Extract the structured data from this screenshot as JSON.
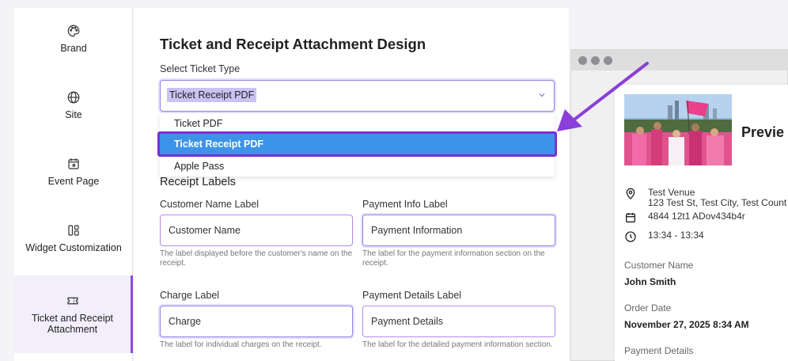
{
  "sidebar": {
    "items": [
      {
        "label": "Brand",
        "icon": "palette-icon"
      },
      {
        "label": "Site",
        "icon": "globe-icon"
      },
      {
        "label": "Event Page",
        "icon": "calendar-icon"
      },
      {
        "label": "Widget Customization",
        "icon": "layout-icon"
      },
      {
        "label": "Ticket and Receipt Attachment",
        "icon": "ticket-icon",
        "active": true
      }
    ]
  },
  "form": {
    "title": "Ticket and Receipt Attachment Design",
    "select_label": "Select Ticket Type",
    "select_value": "Ticket Receipt PDF",
    "options": [
      "Ticket PDF",
      "Ticket Receipt PDF",
      "Apple Pass"
    ],
    "section_title": "Receipt Labels",
    "fields": [
      {
        "label": "Customer Name Label",
        "value": "Customer Name",
        "help": "The label displayed before the customer's name on the receipt."
      },
      {
        "label": "Payment Info Label",
        "value": "Payment Information",
        "help": "The label for the payment information section on the receipt."
      },
      {
        "label": "Charge Label",
        "value": "Charge",
        "help": "The label for individual charges on the receipt."
      },
      {
        "label": "Payment Details Label",
        "value": "Payment Details",
        "help": "The label for the detailed payment information section."
      }
    ]
  },
  "preview": {
    "title": "Previe",
    "venue": "Test Venue",
    "address": "123 Test St, Test City, Test Count",
    "code": "4844 12t1 ADov434b4r",
    "time": "13:34 - 13:34",
    "customer_label": "Customer Name",
    "customer_value": "John Smith",
    "order_label": "Order Date",
    "order_value": "November 27, 2025 8:34 AM",
    "payment_label": "Payment Details"
  },
  "colors": {
    "accent": "#8a4be0",
    "highlight": "#3d93e8",
    "focus_border": "#8f86e8"
  }
}
